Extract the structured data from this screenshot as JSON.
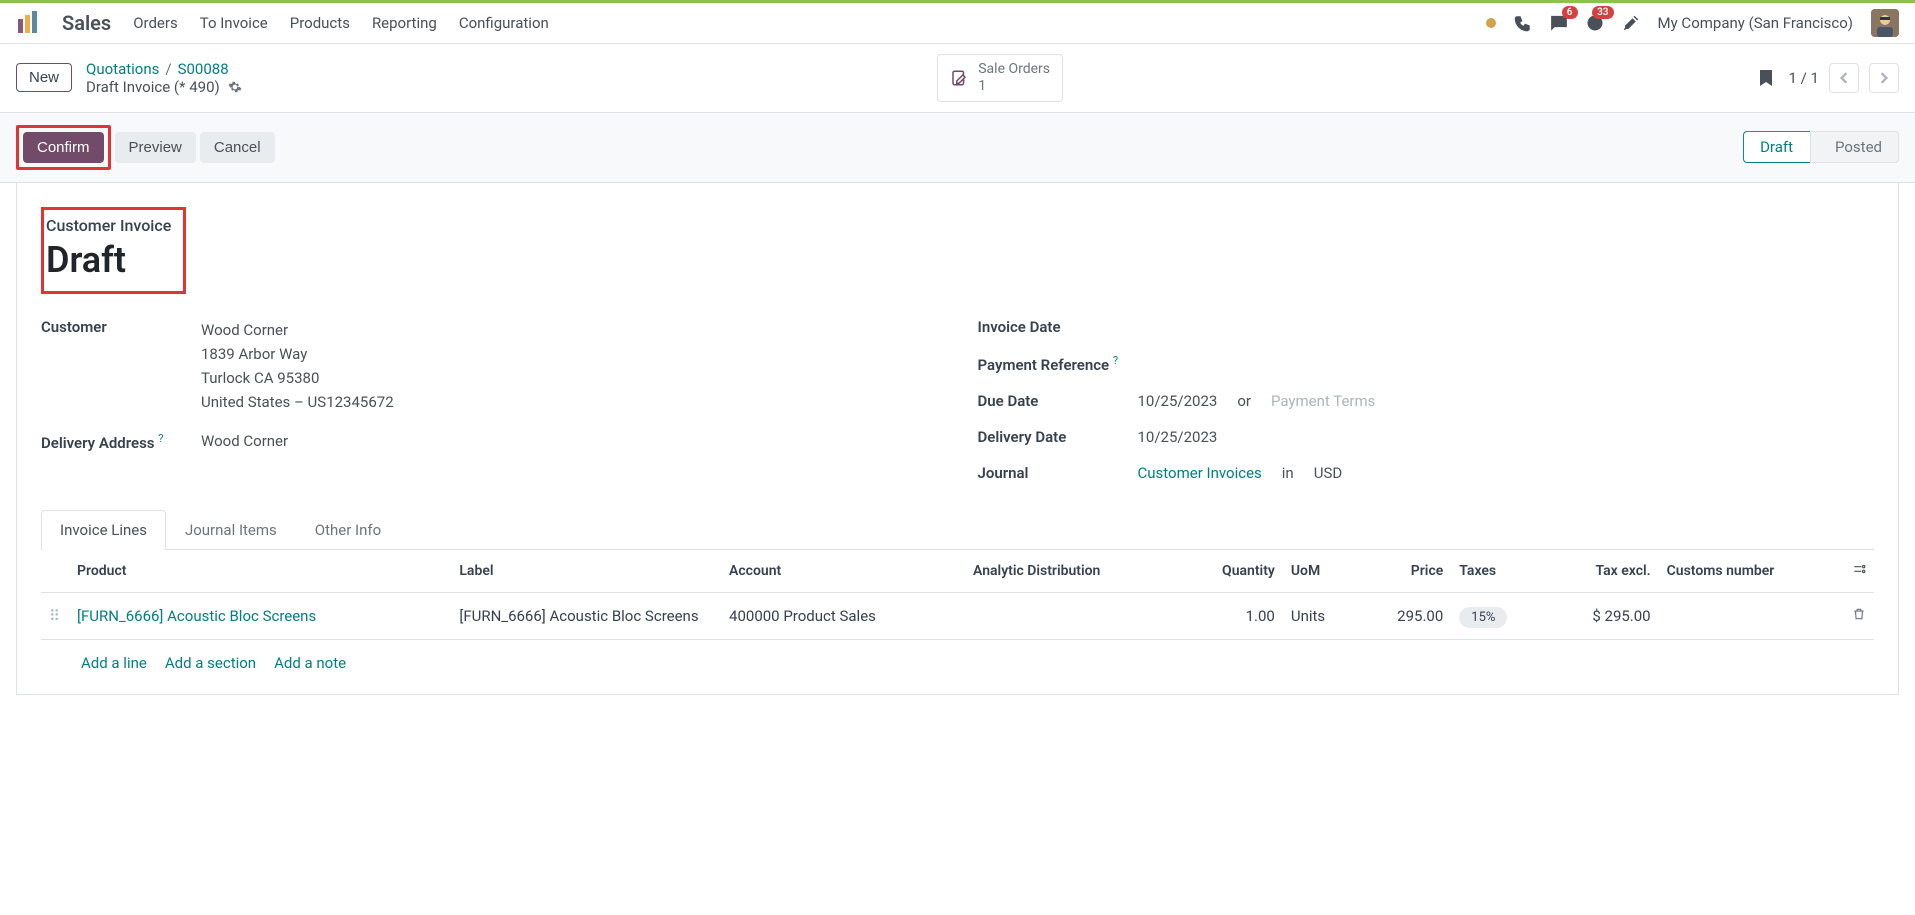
{
  "topbar": {
    "app_name": "Sales",
    "nav": [
      "Orders",
      "To Invoice",
      "Products",
      "Reporting",
      "Configuration"
    ],
    "msg_badge": "6",
    "activity_badge": "33",
    "company": "My Company (San Francisco)"
  },
  "breadcrumb": {
    "new_btn": "New",
    "quotations": "Quotations",
    "order_ref": "S00088",
    "sub": "Draft Invoice (* 490)"
  },
  "stat": {
    "label": "Sale Orders",
    "count": "1"
  },
  "pager": {
    "text": "1 / 1"
  },
  "actions": {
    "confirm": "Confirm",
    "preview": "Preview",
    "cancel": "Cancel"
  },
  "status": {
    "draft": "Draft",
    "posted": "Posted"
  },
  "title": {
    "label": "Customer Invoice",
    "value": "Draft"
  },
  "left_fields": {
    "customer_label": "Customer",
    "customer_name": "Wood Corner",
    "addr1": "1839 Arbor Way",
    "addr2": "Turlock CA 95380",
    "addr3": "United States – US12345672",
    "delivery_label": "Delivery Address",
    "delivery_value": "Wood Corner"
  },
  "right_fields": {
    "invoice_date_label": "Invoice Date",
    "payment_ref_label": "Payment Reference",
    "due_date_label": "Due Date",
    "due_date_value": "10/25/2023",
    "or_text": "or",
    "payment_terms_ph": "Payment Terms",
    "delivery_date_label": "Delivery Date",
    "delivery_date_value": "10/25/2023",
    "journal_label": "Journal",
    "journal_value": "Customer Invoices",
    "in_text": "in",
    "currency": "USD"
  },
  "tabs": {
    "lines": "Invoice Lines",
    "journal": "Journal Items",
    "other": "Other Info"
  },
  "table": {
    "headers": {
      "product": "Product",
      "label": "Label",
      "account": "Account",
      "analytic": "Analytic Distribution",
      "quantity": "Quantity",
      "uom": "UoM",
      "price": "Price",
      "taxes": "Taxes",
      "tax_excl": "Tax excl.",
      "customs": "Customs number"
    },
    "row": {
      "product": "[FURN_6666] Acoustic Bloc Screens",
      "label": "[FURN_6666] Acoustic Bloc Screens",
      "account": "400000 Product Sales",
      "quantity": "1.00",
      "uom": "Units",
      "price": "295.00",
      "tax": "15%",
      "tax_excl": "$ 295.00"
    },
    "actions": {
      "add_line": "Add a line",
      "add_section": "Add a section",
      "add_note": "Add a note"
    }
  }
}
